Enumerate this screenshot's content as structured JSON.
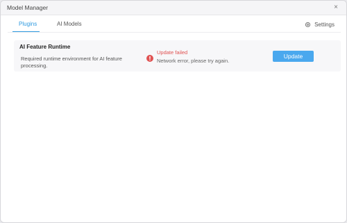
{
  "window": {
    "title": "Model Manager",
    "close_label": "×"
  },
  "tabs": [
    {
      "label": "Plugins",
      "active": true
    },
    {
      "label": "AI Models",
      "active": false
    }
  ],
  "settings": {
    "label": "Settings",
    "icon": "gear-icon"
  },
  "plugin": {
    "name": "AI Feature Runtime",
    "description": "Required runtime environment for AI feature processing.",
    "status_title": "Update failed",
    "status_message": "Network error, please try again.",
    "status_icon": "error-icon",
    "action_label": "Update"
  },
  "colors": {
    "accent": "#2f9ae0",
    "button": "#4aa8ee",
    "error": "#e05252"
  }
}
